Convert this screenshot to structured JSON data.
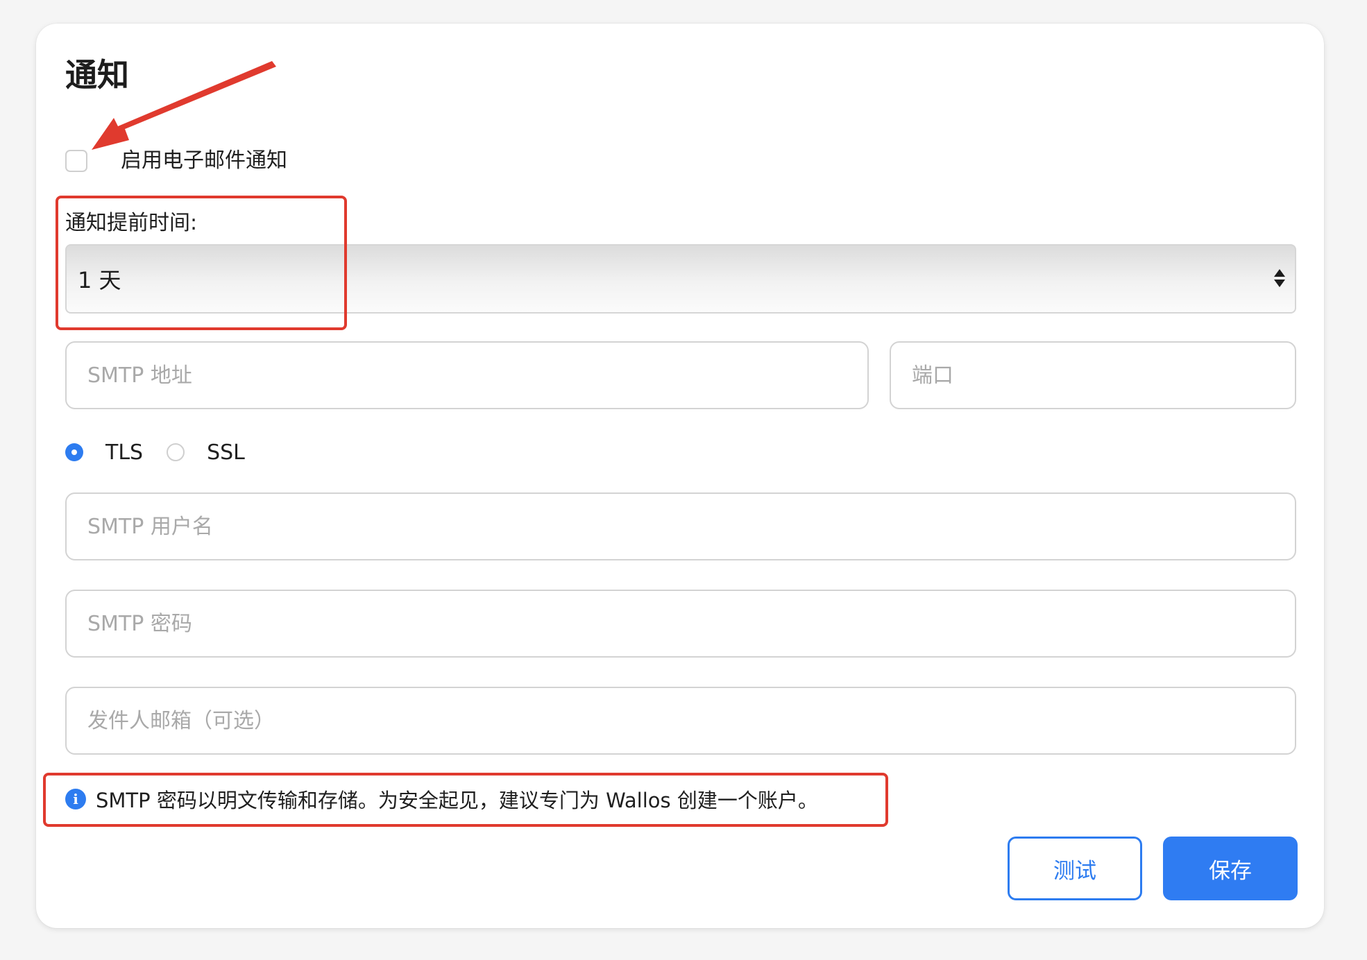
{
  "card": {
    "title": "通知"
  },
  "email_toggle": {
    "label": "启用电子邮件通知",
    "checked": false
  },
  "notify_before": {
    "label": "通知提前时间:",
    "selected": "1 天"
  },
  "smtp": {
    "address_placeholder": "SMTP 地址",
    "port_placeholder": "端口",
    "username_placeholder": "SMTP 用户名",
    "password_placeholder": "SMTP 密码",
    "from_placeholder": "发件人邮箱（可选）"
  },
  "encryption": {
    "options": [
      {
        "label": "TLS",
        "selected": true
      },
      {
        "label": "SSL",
        "selected": false
      }
    ]
  },
  "info": {
    "icon": "info-icon",
    "text": "SMTP 密码以明文传输和存储。为安全起见，建议专门为 Wallos 创建一个账户。"
  },
  "actions": {
    "test_label": "测试",
    "save_label": "保存"
  },
  "colors": {
    "accent": "#2d7cf0",
    "annotation": "#e03a2e"
  }
}
